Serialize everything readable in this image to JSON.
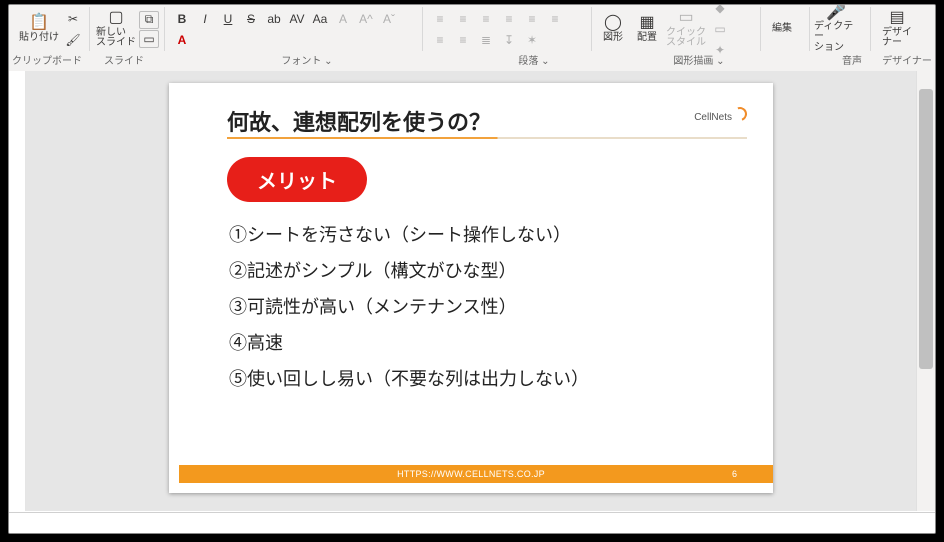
{
  "ribbon": {
    "clipboard": {
      "paste": "貼り付け",
      "label": "クリップボード"
    },
    "slide": {
      "new": "新しい\nスライド",
      "layout_icon": "⧉",
      "reset_icon": "▭",
      "label": "スライド"
    },
    "font": {
      "bold": "B",
      "italic": "I",
      "underline": "U",
      "strike": "S",
      "spacing": "ab",
      "case": "AV",
      "fontsize": "Aa",
      "clear": "A",
      "grow": "A^",
      "shrink": "Aˇ",
      "color": "A",
      "label": "フォント"
    },
    "paragraph": {
      "bullets": "≡",
      "numbering": "≡",
      "indent_dec": "≡",
      "indent_inc": "≡",
      "left": "≡",
      "center": "≡",
      "right": "≡",
      "just": "≡",
      "columns": "≣",
      "dir": "↧",
      "smart": "✶",
      "label": "段落"
    },
    "drawing": {
      "shapes": "図形",
      "arrange": "配置",
      "quickstyle": "クイック\nスタイル",
      "label": "図形描画"
    },
    "editing": {
      "btn": "編集",
      "label": ""
    },
    "voice": {
      "btn": "ディクテー\nション",
      "label": "音声"
    },
    "designer": {
      "btn": "デザイ\nナー",
      "label": "デザイナー"
    }
  },
  "slideContent": {
    "title": "何故、連想配列を使うの？",
    "logo": "CellNets",
    "badge": "メリット",
    "merits": [
      "①シートを汚さない（シート操作しない）",
      "②記述がシンプル（構文がひな型）",
      "③可読性が高い（メンテナンス性）",
      "④高速",
      "⑤使い回しし易い（不要な列は出力しない）"
    ],
    "footer_url": "HTTPS://WWW.CELLNETS.CO.JP",
    "page": "6"
  },
  "status": {
    "left": ""
  }
}
